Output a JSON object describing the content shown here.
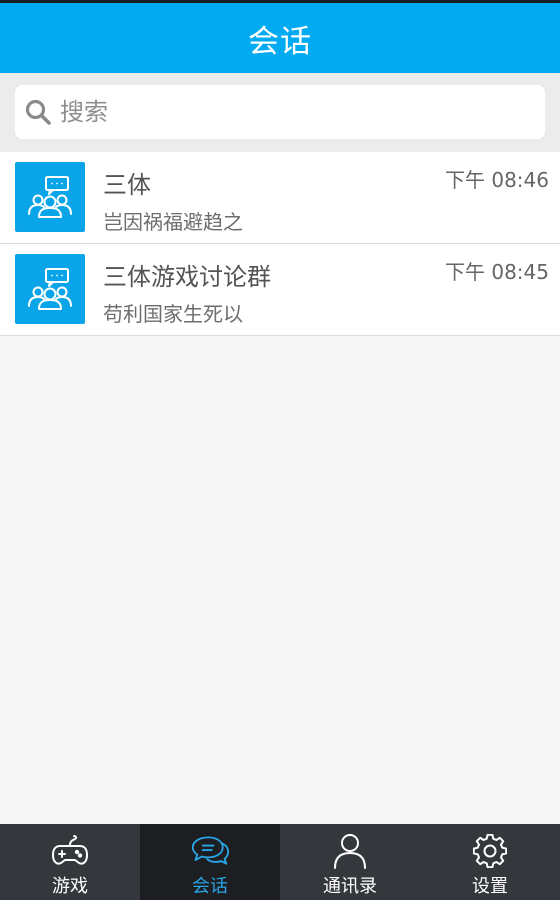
{
  "header": {
    "title": "会话"
  },
  "search": {
    "placeholder": "搜索",
    "icon": "search-icon"
  },
  "conversations": [
    {
      "name": "三体",
      "time": "下午 08:46",
      "preview": "岂因祸福避趋之",
      "avatar_icon": "group-chat-icon"
    },
    {
      "name": "三体游戏讨论群",
      "time": "下午 08:45",
      "preview": "苟利国家生死以",
      "avatar_icon": "group-chat-icon"
    }
  ],
  "tabs": [
    {
      "label": "游戏",
      "icon": "gamepad-icon",
      "active": false
    },
    {
      "label": "会话",
      "icon": "chat-bubbles-icon",
      "active": true
    },
    {
      "label": "通讯录",
      "icon": "contacts-icon",
      "active": false
    },
    {
      "label": "设置",
      "icon": "gear-icon",
      "active": false
    }
  ],
  "colors": {
    "header_bg": "#01aaf1",
    "avatar_bg": "#0aa4e8",
    "tab_bar_bg": "#34373b",
    "tab_active_bg": "#1c1e21",
    "tab_active_text": "#2aa5e6"
  }
}
